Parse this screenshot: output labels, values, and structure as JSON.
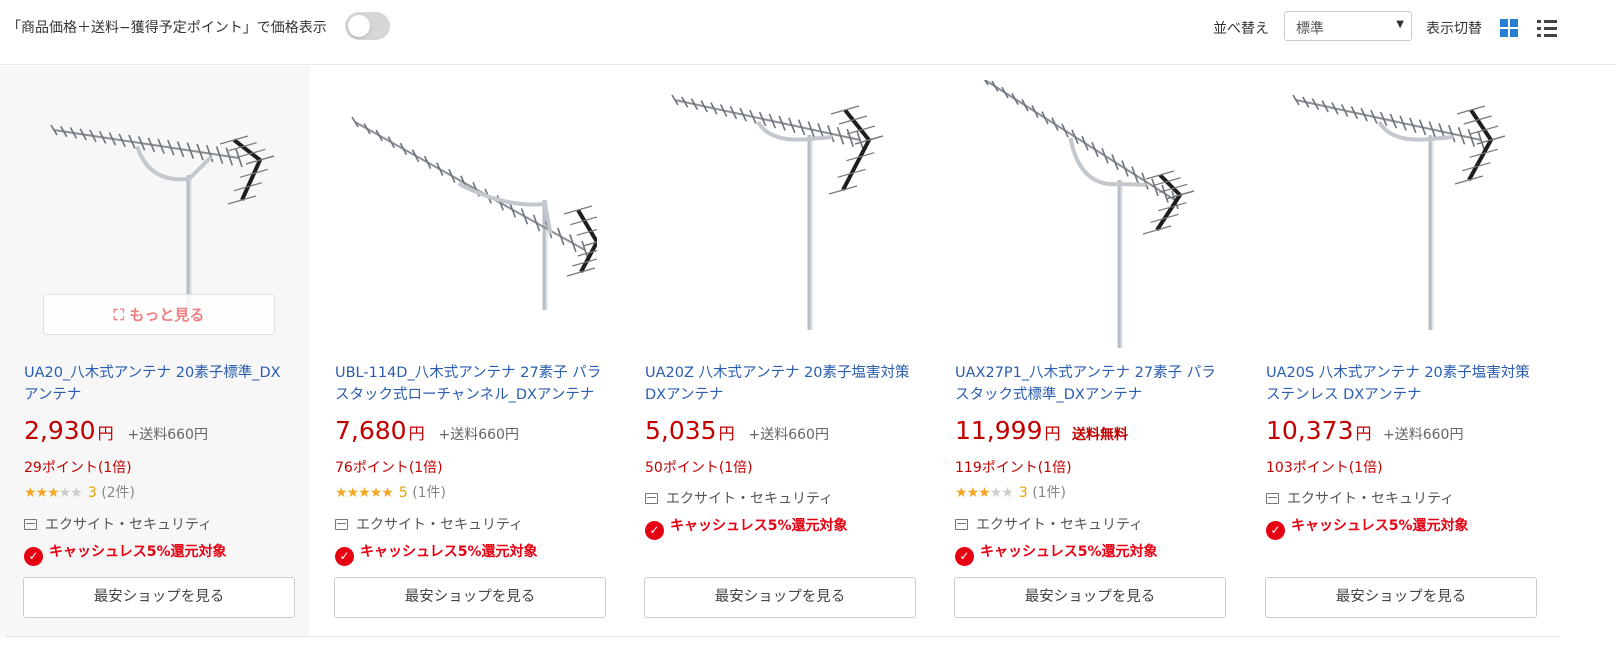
{
  "toolbar": {
    "toggle_label": "「商品価格＋送料−獲得予定ポイント」で価格表示",
    "sort_label": "並べ替え",
    "sort_value": "標準",
    "view_label": "表示切替"
  },
  "more_label": "もっと見る",
  "cheapest_label": "最安ショップを見る",
  "yen": "円",
  "cashless_label": "キャッシュレス5%還元対象",
  "products": [
    {
      "title": "UA20_八木式アンテナ 20素子標準_DXアンテナ",
      "price": "2,930",
      "shipping": "+送料660円",
      "points": "29ポイント(1倍)",
      "stars": 3,
      "rating": "3",
      "reviews": "(2件)",
      "shop": "エクサイト・セキュリティ",
      "cashless": true
    },
    {
      "title": "UBL-114D_八木式アンテナ 27素子 パラスタック式ローチャンネル_DXアンテナ",
      "price": "7,680",
      "shipping": "+送料660円",
      "points": "76ポイント(1倍)",
      "stars": 5,
      "rating": "5",
      "reviews": "(1件)",
      "shop": "エクサイト・セキュリティ",
      "cashless": true
    },
    {
      "title": "UA20Z 八木式アンテナ 20素子塩害対策DXアンテナ",
      "price": "5,035",
      "shipping": "+送料660円",
      "points": "50ポイント(1倍)",
      "stars": 0,
      "rating": "",
      "reviews": "",
      "shop": "エクサイト・セキュリティ",
      "cashless": true
    },
    {
      "title": "UAX27P1_八木式アンテナ 27素子 パラスタック式標準_DXアンテナ",
      "price": "11,999",
      "shipping": "送料無料",
      "points": "119ポイント(1倍)",
      "stars": 3,
      "rating": "3",
      "reviews": "(1件)",
      "shop": "エクサイト・セキュリティ",
      "cashless": true
    },
    {
      "title": "UA20S 八木式アンテナ 20素子塩害対策ステンレス DXアンテナ",
      "price": "10,373",
      "shipping": "+送料660円",
      "points": "103ポイント(1倍)",
      "stars": 0,
      "rating": "",
      "reviews": "",
      "shop": "エクサイト・セキュリティ",
      "cashless": true
    }
  ]
}
